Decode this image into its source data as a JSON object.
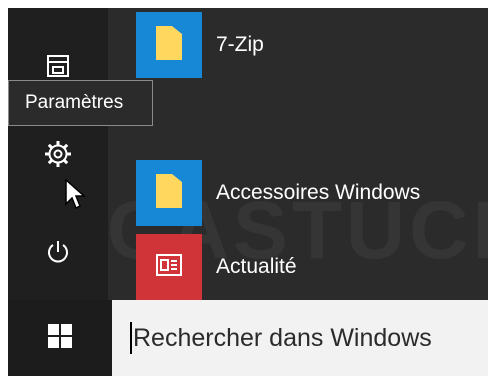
{
  "tooltip": {
    "text": "Paramètres"
  },
  "apps": [
    {
      "label": "7-Zip",
      "tile_color": "#1688d6",
      "icon": "folder-icon"
    },
    {
      "label": "Accessoires Windows",
      "tile_color": "#1688d6",
      "icon": "folder-icon"
    },
    {
      "label": "Actualité",
      "tile_color": "#d13438",
      "icon": "news-icon"
    }
  ],
  "rail": [
    "file-explorer-icon",
    "settings-gear-icon",
    "power-icon"
  ],
  "search": {
    "placeholder": "Rechercher dans Windows"
  },
  "watermark": "PCASTUCES",
  "colors": {
    "panel": "#2b2b2b",
    "rail": "#1f1f1f",
    "taskbar": "#1c1c1c",
    "search_bg": "#f2f2f2",
    "accent_blue": "#1688d6",
    "news_red": "#d13438",
    "folder_yellow": "#ffd75e"
  }
}
